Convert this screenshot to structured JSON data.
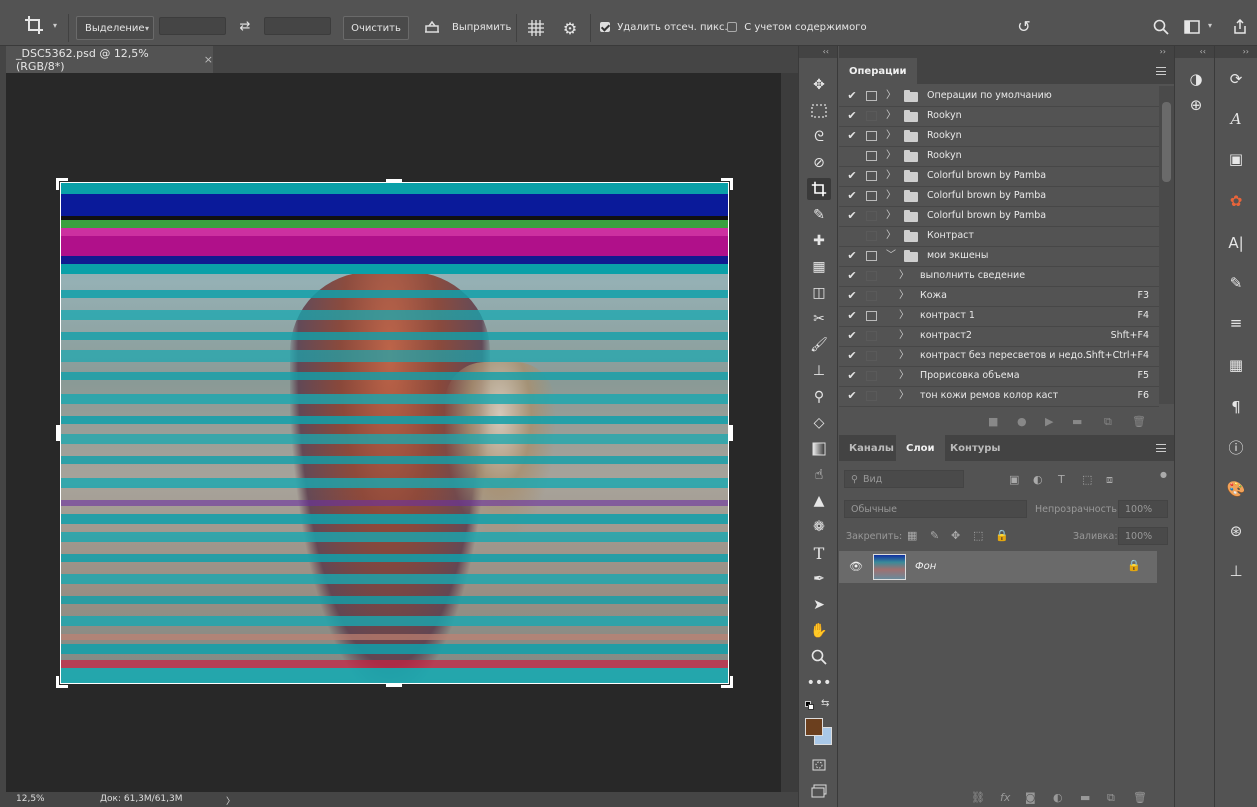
{
  "options_bar": {
    "mode_dropdown": "Выделение",
    "clear_button": "Очистить",
    "straighten_label": "Выпрямить",
    "delete_cropped": "Удалить отсеч. пикс.",
    "content_aware": "С учетом содержимого"
  },
  "document": {
    "tab_title": "_DSC5362.psd @ 12,5% (RGB/8*)",
    "close_glyph": "×"
  },
  "status": {
    "zoom": "12,5%",
    "doc_info": "Док: 61,3M/61,3M",
    "arrow": "〉"
  },
  "actions_panel": {
    "title": "Операции",
    "items": [
      {
        "checked": true,
        "dialog": true,
        "twirl": "〉",
        "folder": true,
        "name": "Операции по умолчанию",
        "shortcut": ""
      },
      {
        "checked": true,
        "dialog": false,
        "twirl": "〉",
        "folder": true,
        "name": "Rookyn",
        "shortcut": ""
      },
      {
        "checked": true,
        "dialog": true,
        "twirl": "〉",
        "folder": true,
        "name": "Rookyn",
        "shortcut": ""
      },
      {
        "checked": false,
        "dialog": true,
        "twirl": "〉",
        "folder": true,
        "name": "Rookyn",
        "shortcut": ""
      },
      {
        "checked": true,
        "dialog": true,
        "twirl": "〉",
        "folder": true,
        "name": "Colorful brown by Pamba",
        "shortcut": ""
      },
      {
        "checked": true,
        "dialog": true,
        "twirl": "〉",
        "folder": true,
        "name": "Colorful brown by Pamba",
        "shortcut": ""
      },
      {
        "checked": true,
        "dialog": false,
        "twirl": "〉",
        "folder": true,
        "name": "Colorful brown by Pamba",
        "shortcut": ""
      },
      {
        "checked": false,
        "dialog": false,
        "twirl": "〉",
        "folder": true,
        "name": "Контраст",
        "shortcut": ""
      },
      {
        "checked": true,
        "dialog": true,
        "twirl": "﹀",
        "folder": true,
        "name": "мои экшены",
        "shortcut": ""
      },
      {
        "checked": true,
        "dialog": false,
        "twirl": "〉",
        "folder": false,
        "name": "выполнить сведение",
        "shortcut": ""
      },
      {
        "checked": true,
        "dialog": false,
        "twirl": "〉",
        "folder": false,
        "name": "Кожа",
        "shortcut": "F3"
      },
      {
        "checked": true,
        "dialog": true,
        "twirl": "〉",
        "folder": false,
        "name": "контраст 1",
        "shortcut": "F4"
      },
      {
        "checked": true,
        "dialog": false,
        "twirl": "〉",
        "folder": false,
        "name": "контраст2",
        "shortcut": "Shft+F4"
      },
      {
        "checked": true,
        "dialog": false,
        "twirl": "〉",
        "folder": false,
        "name": "контраст без пересветов и недо...",
        "shortcut": "Shft+Ctrl+F4"
      },
      {
        "checked": true,
        "dialog": false,
        "twirl": "〉",
        "folder": false,
        "name": "Прорисовка объема",
        "shortcut": "F5"
      },
      {
        "checked": true,
        "dialog": false,
        "twirl": "〉",
        "folder": false,
        "name": "тон кожи ремов колор каст",
        "shortcut": "F6"
      }
    ],
    "check_glyph": "✔"
  },
  "layers_panel": {
    "tabs": [
      "Каналы",
      "Слои",
      "Контуры"
    ],
    "search_placeholder": "Вид",
    "blend_mode": "Обычные",
    "opacity_label": "Непрозрачность:",
    "opacity_value": "100%",
    "lock_label": "Закрепить:",
    "fill_label": "Заливка:",
    "fill_value": "100%",
    "layer_name": "Фон"
  },
  "colors": {
    "foreground": "#6b3f1e",
    "background": "#a9c8e8"
  }
}
